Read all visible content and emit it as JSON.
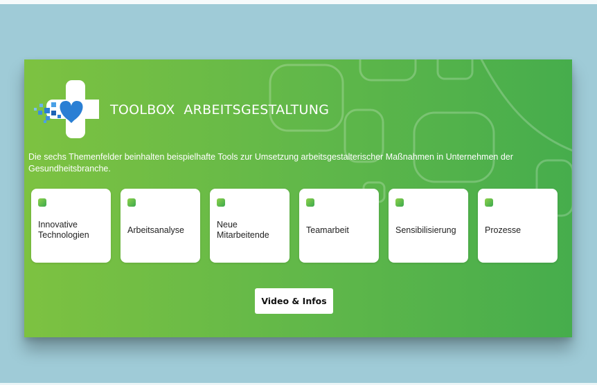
{
  "header": {
    "title": "TOOLBOX  ARBEITSGESTALTUNG",
    "intro": "Die sechs Themenfelder beinhalten beispielhafte Tools zur Umsetzung arbeitsgestalterischer Maßnahmen in Unternehmen der Gesundheitsbranche."
  },
  "topics": [
    {
      "label": "Innovative Technologien"
    },
    {
      "label": "Arbeitsanalyse"
    },
    {
      "label": "Neue Mitarbeitende"
    },
    {
      "label": "Teamarbeit"
    },
    {
      "label": "Sensibilisierung"
    },
    {
      "label": "Prozesse"
    }
  ],
  "actions": {
    "video_label": "Video & Infos"
  },
  "icons": {
    "logo": "health-cross-heart-logo",
    "topic_marker": "square-marker-icon"
  },
  "colors": {
    "page_background": "#9fcbd7",
    "panel_gradient_start": "#7dc241",
    "panel_gradient_end": "#46ad4c",
    "card_background": "#ffffff",
    "heart_blue": "#2a7fd4",
    "marker_green": "#5cbf45"
  }
}
